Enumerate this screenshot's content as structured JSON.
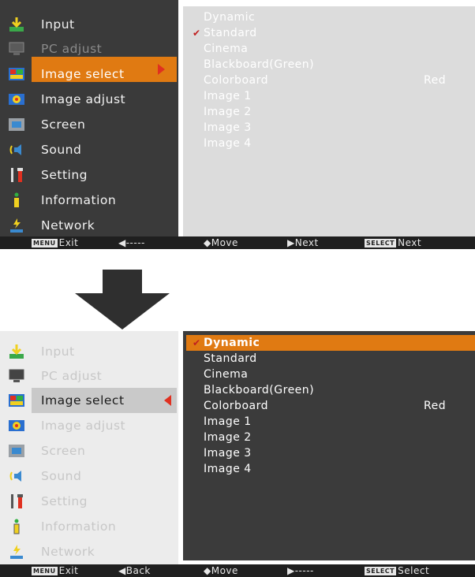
{
  "top": {
    "menu": [
      {
        "label": "Input",
        "icon": "input-icon",
        "state": "normal"
      },
      {
        "label": "PC adjust",
        "icon": "pc-adjust-icon",
        "state": "dim"
      },
      {
        "label": "Image select",
        "icon": "image-select-icon",
        "state": "selected"
      },
      {
        "label": "Image adjust",
        "icon": "image-adjust-icon",
        "state": "normal"
      },
      {
        "label": "Screen",
        "icon": "screen-icon",
        "state": "normal"
      },
      {
        "label": "Sound",
        "icon": "sound-icon",
        "state": "normal"
      },
      {
        "label": "Setting",
        "icon": "setting-icon",
        "state": "normal"
      },
      {
        "label": "Information",
        "icon": "information-icon",
        "state": "normal"
      },
      {
        "label": "Network",
        "icon": "network-icon",
        "state": "normal"
      }
    ],
    "list": [
      {
        "label": "Dynamic",
        "checked": false,
        "value": ""
      },
      {
        "label": "Standard",
        "checked": true,
        "value": ""
      },
      {
        "label": "Cinema",
        "checked": false,
        "value": ""
      },
      {
        "label": "Blackboard(Green)",
        "checked": false,
        "value": ""
      },
      {
        "label": "Colorboard",
        "checked": false,
        "value": "Red"
      },
      {
        "label": "Image 1",
        "checked": false,
        "value": ""
      },
      {
        "label": "Image 2",
        "checked": false,
        "value": ""
      },
      {
        "label": "Image 3",
        "checked": false,
        "value": ""
      },
      {
        "label": "Image 4",
        "checked": false,
        "value": ""
      }
    ],
    "status": {
      "menu_badge": "MENU",
      "exit": "Exit",
      "back": "◀-----",
      "move": "◆Move",
      "next": "▶Next",
      "select_badge": "SELECT",
      "select": "Next"
    }
  },
  "bottom": {
    "menu": [
      {
        "label": "Input",
        "icon": "input-icon",
        "state": "dim"
      },
      {
        "label": "PC adjust",
        "icon": "pc-adjust-icon",
        "state": "dim"
      },
      {
        "label": "Image select",
        "icon": "image-select-icon",
        "state": "selected"
      },
      {
        "label": "Image adjust",
        "icon": "image-adjust-icon",
        "state": "dim"
      },
      {
        "label": "Screen",
        "icon": "screen-icon",
        "state": "dim"
      },
      {
        "label": "Sound",
        "icon": "sound-icon",
        "state": "dim"
      },
      {
        "label": "Setting",
        "icon": "setting-icon",
        "state": "dim"
      },
      {
        "label": "Information",
        "icon": "information-icon",
        "state": "dim"
      },
      {
        "label": "Network",
        "icon": "network-icon",
        "state": "dim"
      }
    ],
    "list": [
      {
        "label": "Dynamic",
        "checked": true,
        "value": "",
        "highlighted": true
      },
      {
        "label": "Standard",
        "checked": false,
        "value": ""
      },
      {
        "label": "Cinema",
        "checked": false,
        "value": ""
      },
      {
        "label": "Blackboard(Green)",
        "checked": false,
        "value": ""
      },
      {
        "label": "Colorboard",
        "checked": false,
        "value": "Red"
      },
      {
        "label": "Image 1",
        "checked": false,
        "value": ""
      },
      {
        "label": "Image 2",
        "checked": false,
        "value": ""
      },
      {
        "label": "Image 3",
        "checked": false,
        "value": ""
      },
      {
        "label": "Image 4",
        "checked": false,
        "value": ""
      }
    ],
    "status": {
      "menu_badge": "MENU",
      "exit": "Exit",
      "back": "◀Back",
      "move": "◆Move",
      "next": "▶-----",
      "select_badge": "SELECT",
      "select": "Select"
    }
  },
  "colors": {
    "accent": "#e07a12",
    "check": "#c02020"
  }
}
